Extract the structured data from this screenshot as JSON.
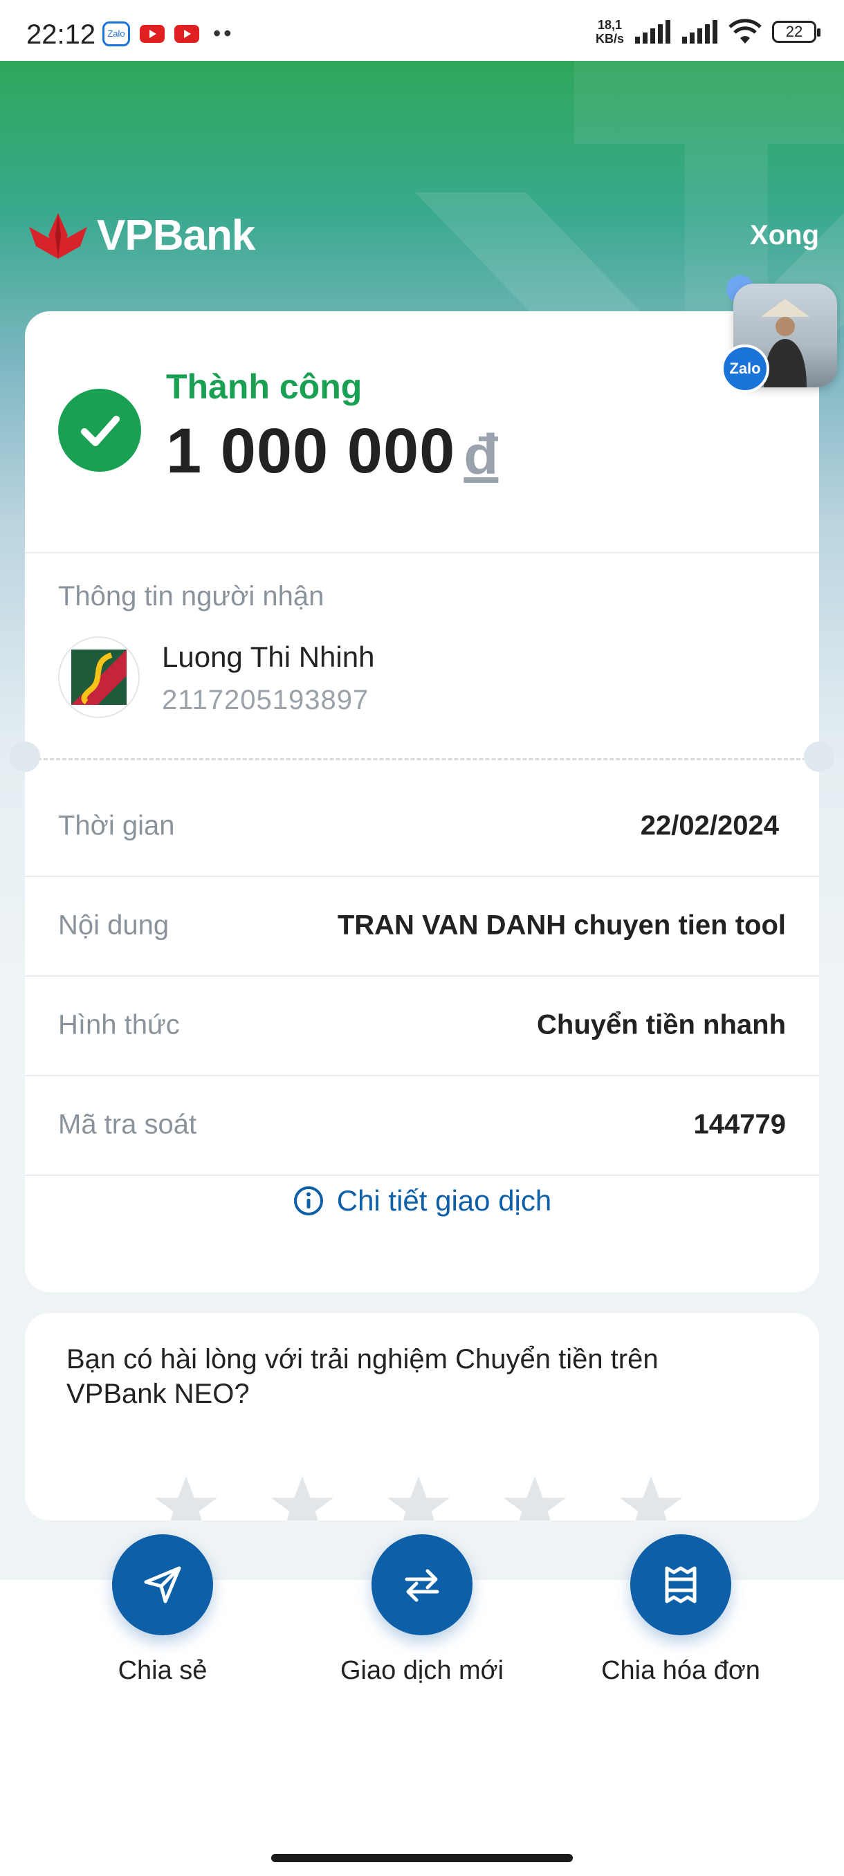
{
  "status_bar": {
    "time": "22:12",
    "app_icons": [
      "zalo-icon",
      "youtube-icon",
      "youtube-icon"
    ],
    "more_dots": "••",
    "net_speed_value": "18,1",
    "net_speed_unit": "KB/s",
    "battery": "22"
  },
  "header": {
    "brand": "VPBank",
    "done_label": "Xong"
  },
  "result": {
    "status": "Thành công",
    "amount": "1 000 000",
    "currency": "đ"
  },
  "recipient": {
    "caption": "Thông tin người nhận",
    "name": "Luong Thi Nhinh",
    "account": "2117205193897"
  },
  "details": [
    {
      "label": "Thời gian",
      "value": "22/02/2024"
    },
    {
      "label": "Nội dung",
      "value": "TRAN VAN DANH chuyen tien tool"
    },
    {
      "label": "Hình thức",
      "value": "Chuyển tiền nhanh"
    },
    {
      "label": "Mã tra soát",
      "value": "144779"
    }
  ],
  "detail_link": "Chi tiết giao dịch",
  "survey": {
    "question": "Bạn có hài lòng với trải nghiệm Chuyển tiền trên VPBank NEO?",
    "stars": 5
  },
  "actions": [
    {
      "label": "Chia sẻ",
      "icon": "send-icon"
    },
    {
      "label": "Giao dịch mới",
      "icon": "swap-arrows-icon"
    },
    {
      "label": "Chia hóa đơn",
      "icon": "receipt-icon"
    }
  ],
  "floating": {
    "badge": "Zalo"
  },
  "colors": {
    "success": "#1aa053",
    "primary": "#0d5fa8",
    "hero_green": "#2fa65a"
  }
}
